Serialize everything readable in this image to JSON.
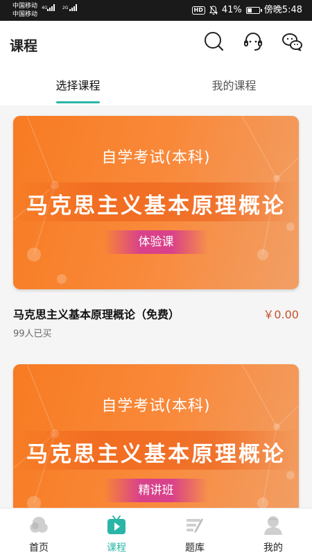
{
  "status_bar": {
    "carrier_1": "中国移动",
    "carrier_2": "中国移动",
    "network_1": "4G",
    "network_2": "2G",
    "hd": "HD",
    "battery_text": "41%",
    "battery_level": 0.41,
    "time": "傍晚5:48"
  },
  "header": {
    "title": "课程",
    "icons": [
      "search-icon",
      "customer-service-icon",
      "chat-icon"
    ]
  },
  "tabs": [
    {
      "label": "选择课程",
      "active": true
    },
    {
      "label": "我的课程",
      "active": false
    }
  ],
  "courses": [
    {
      "banner_top": "自学考试(本科)",
      "banner_main": "马克思主义基本原理概论",
      "banner_tag": "体验课",
      "name": "马克思主义基本原理概论（免费）",
      "price": "￥0.00",
      "sold": "99人已买"
    },
    {
      "banner_top": "自学考试(本科)",
      "banner_main": "马克思主义基本原理概论",
      "banner_tag": "精讲班"
    }
  ],
  "bottom_nav": [
    {
      "label": "首页",
      "icon": "home-icon",
      "active": false
    },
    {
      "label": "课程",
      "icon": "course-play-icon",
      "active": true
    },
    {
      "label": "题库",
      "icon": "question-bank-icon",
      "active": false
    },
    {
      "label": "我的",
      "icon": "profile-icon",
      "active": false
    }
  ],
  "colors": {
    "accent": "#2bb5a7",
    "banner_orange": "#f77b22",
    "price": "#c5512b",
    "tag_pink": "#d9418a"
  }
}
